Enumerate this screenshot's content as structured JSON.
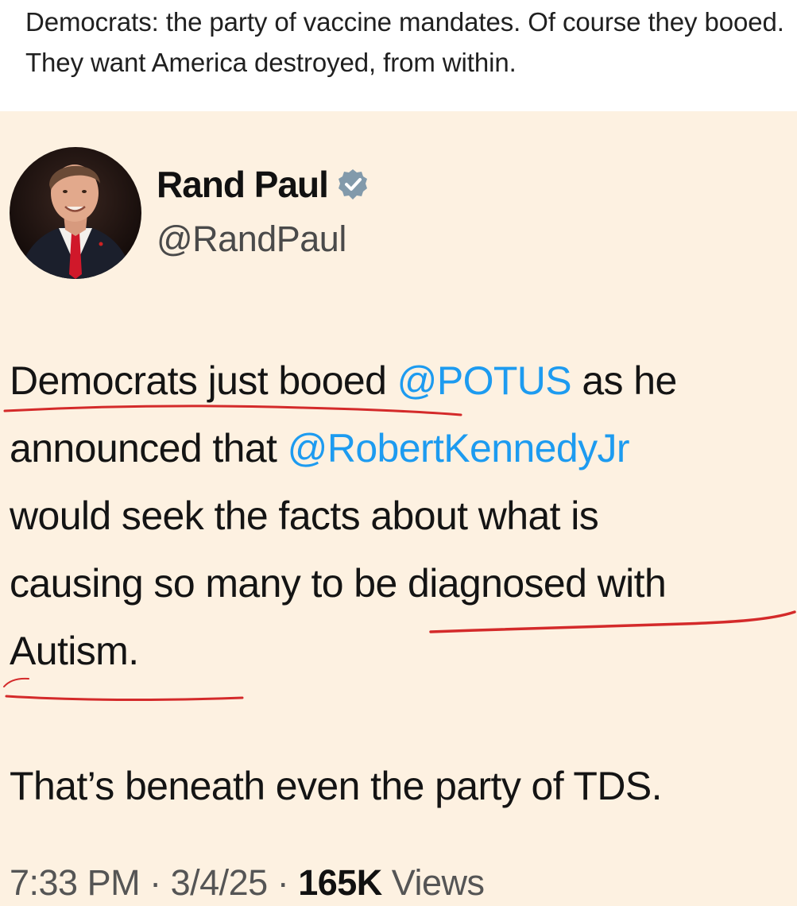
{
  "caption": {
    "text": "Democrats: the party of vaccine mandates. Of course they booed. They want America destroyed, from within."
  },
  "tweet": {
    "author": {
      "display_name": "Rand Paul",
      "handle": "@RandPaul",
      "verified_icon": "verified-badge-icon"
    },
    "body": {
      "line1_pre": "Democrats just booed ",
      "line1_mention": "@POTUS",
      "line1_post": " as he",
      "line2_pre": "announced that ",
      "line2_mention": "@RobertKennedyJr",
      "line3": "would seek the facts about what is",
      "line4": "causing so many to be diagnosed with",
      "line5": "Autism.",
      "line7": "That’s beneath even the party of TDS."
    },
    "meta": {
      "time": "7:33 PM",
      "separator1": " · ",
      "date": "3/4/25",
      "separator2": " · ",
      "views_count": "165K",
      "views_label": " Views"
    }
  },
  "colors": {
    "card_background": "#fdf1e1",
    "mention": "#1d9bf0",
    "annotation_red": "#d42a2a",
    "verified_badge": "#829aab"
  }
}
